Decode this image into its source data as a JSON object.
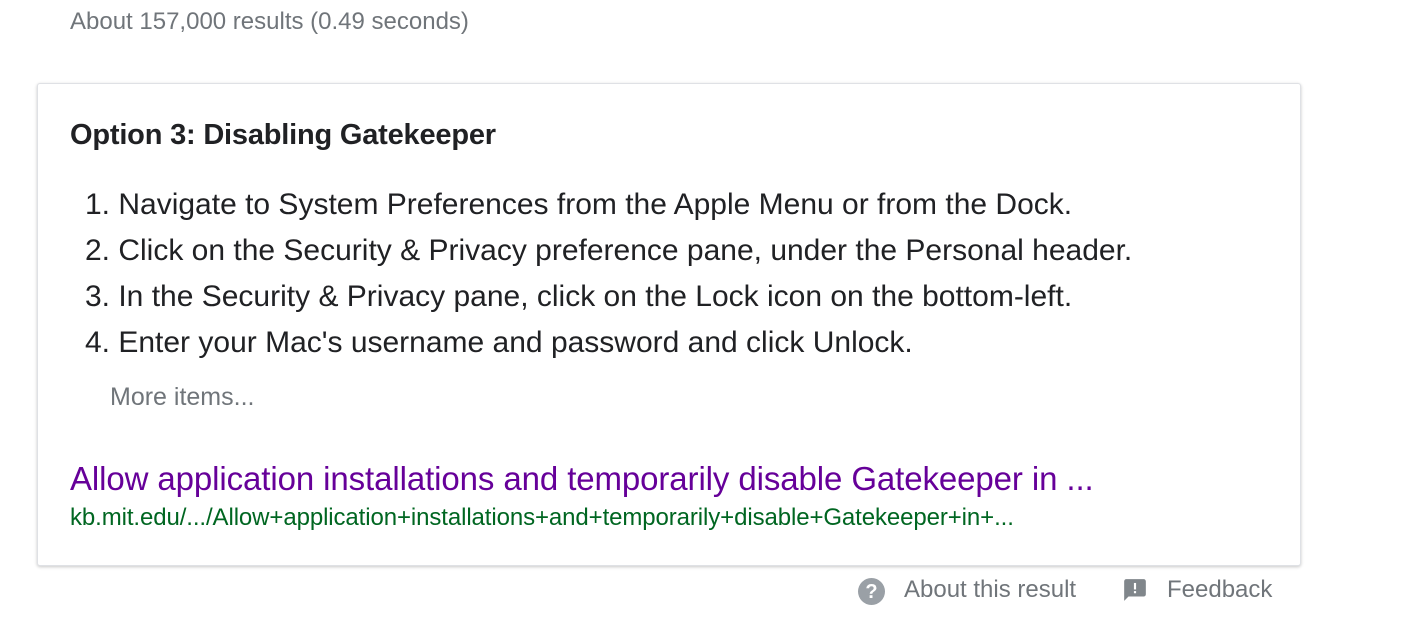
{
  "search": {
    "result_stats": "About 157,000 results (0.49 seconds)"
  },
  "featured_snippet": {
    "title": "Option 3: Disabling Gatekeeper",
    "steps": [
      {
        "number": "1.",
        "text": "Navigate to System Preferences from the Apple Menu or from the Dock."
      },
      {
        "number": "2.",
        "text": "Click on the Security & Privacy preference pane, under the Personal header."
      },
      {
        "number": "3.",
        "text": "In the Security & Privacy pane, click on the Lock icon on the bottom-left."
      },
      {
        "number": "4.",
        "text": "Enter your Mac's username and password and click Unlock."
      }
    ],
    "more_items_label": "More items...",
    "source_title": "Allow application installations and temporarily disable Gatekeeper in ...",
    "source_url": "kb.mit.edu/.../Allow+application+installations+and+temporarily+disable+Gatekeeper+in+..."
  },
  "footer": {
    "about_label": "About this result",
    "about_icon": "help-circle-icon",
    "feedback_label": "Feedback",
    "feedback_icon": "feedback-icon"
  },
  "colors": {
    "link_visited": "#660099",
    "url_green": "#006621",
    "muted_gray": "#70757a",
    "text_dark": "#202124"
  }
}
